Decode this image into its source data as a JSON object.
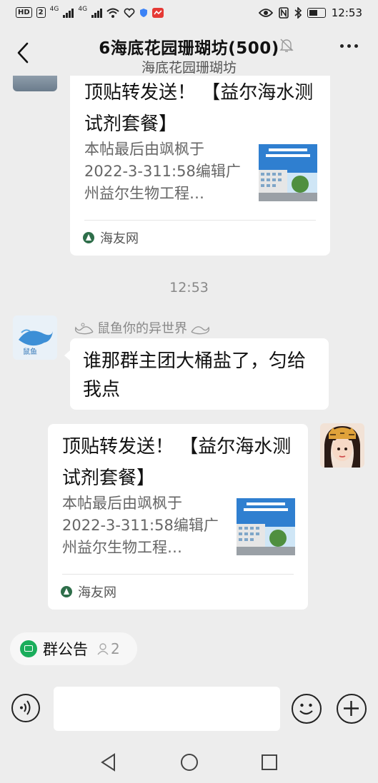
{
  "status_bar": {
    "network_badge": "HD",
    "sim1": "2",
    "signal1": "4G",
    "signal2": "4G",
    "time": "12:53"
  },
  "header": {
    "title": "6海底花园珊瑚坊(500)",
    "subtitle": "海底花园珊瑚坊"
  },
  "messages": {
    "card1": {
      "title": "顶贴转发送！ 【益尔海水测试剂套餐】",
      "desc": "本帖最后由飒枫于2022-3-311:58编辑广州益尔生物工程…",
      "source": "海友网"
    },
    "timestamp": "12:53",
    "text_msg": {
      "sender": "鼠鱼你的异世界",
      "text": "谁那群主团大桶盐了，匀给我点"
    },
    "card2": {
      "title": "顶贴转发送！ 【益尔海水测试剂套餐】",
      "desc": "本帖最后由飒枫于2022-3-311:58编辑广州益尔生物工程…",
      "source": "海友网"
    }
  },
  "bottom": {
    "notice_label": "群公告",
    "notice_count": "2"
  },
  "colors": {
    "background": "#ededed",
    "bubble": "#ffffff",
    "accent_green": "#1aad5b"
  }
}
